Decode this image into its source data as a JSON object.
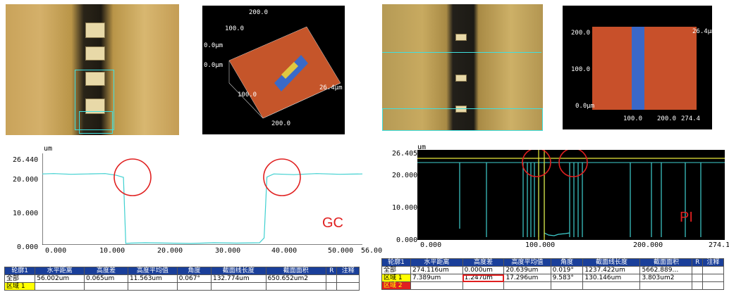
{
  "top": {
    "panel2": {
      "label_100_top": "100.0",
      "label_200_top": "200.0",
      "label_0_a": "0.0μm",
      "label_0_b": "0.0μm",
      "label_100_bottom": "100.0",
      "label_200_bottom": "200.0",
      "label_z": "26.4μm"
    },
    "panel4": {
      "y_200": "200.0",
      "y_100": "100.0",
      "x_0": "0.0μm",
      "x_100": "100.0",
      "x_200": "200.0",
      "x_end": "274.4",
      "z_label": "26.4μm"
    }
  },
  "gc_chart": {
    "unit": "um",
    "y_ticks": [
      "26.440",
      "20.000",
      "10.000",
      "0.000"
    ],
    "x_ticks": [
      "0.000",
      "10.000",
      "20.000",
      "30.000",
      "40.000",
      "50.000",
      "56.00"
    ],
    "label": "GC",
    "chart_data": {
      "type": "line",
      "x": [
        0,
        2,
        5,
        8,
        11,
        13,
        14.2,
        14.6,
        15.5,
        18,
        22,
        26,
        30,
        34,
        38,
        38.8,
        39.3,
        40.5,
        44,
        48,
        52,
        56
      ],
      "values": [
        20.5,
        20.6,
        20.4,
        20.5,
        20.6,
        20.1,
        19.5,
        0.4,
        0.5,
        0.6,
        0.5,
        0.4,
        0.6,
        0.5,
        0.6,
        2,
        19.6,
        20.5,
        20.3,
        20.6,
        20.4,
        20.5
      ],
      "ylim": [
        0,
        26.44
      ],
      "xlim": [
        0,
        56
      ]
    }
  },
  "pi_chart": {
    "unit": "um",
    "y_ticks": [
      "26.405",
      "20.000",
      "10.000",
      "0.000"
    ],
    "x_ticks": [
      "0.000",
      "100.000",
      "200.000",
      "274.1"
    ],
    "label": "PI",
    "ylim": [
      0,
      26.405
    ],
    "xlim": [
      0,
      274.116
    ]
  },
  "gc_table": {
    "headers": [
      "轮廓1",
      "水平距离",
      "高度差",
      "高度平均值",
      "角度",
      "截面线长度",
      "截面面积",
      "R",
      "注释"
    ],
    "rows": [
      [
        "全部",
        "56.002um",
        "0.065um",
        "11.563um",
        "0.067°",
        "132.774um",
        "650.652um2",
        "",
        ""
      ],
      [
        "区域 1",
        "",
        "",
        "",
        "",
        "",
        "",
        "",
        ""
      ]
    ]
  },
  "pi_table": {
    "headers": [
      "轮廓1",
      "水平距离",
      "高度差",
      "高度平均值",
      "角度",
      "截面线长度",
      "截面面积",
      "R",
      "注释"
    ],
    "rows": [
      [
        "全部",
        "274.116um",
        "0.000um",
        "20.639um",
        "0.019°",
        "1237.422um",
        "5662.889…",
        "",
        ""
      ],
      [
        "区域 1",
        "7.389um",
        "1.247um",
        "17.296um",
        "9.583°",
        "130.146um",
        "3.803um2",
        "",
        ""
      ],
      [
        "区域 2",
        "",
        "",
        "",
        "",
        "",
        "",
        "",
        ""
      ]
    ]
  },
  "colors": {
    "trace": "#3fd0d0",
    "highlight_circle": "#e02020",
    "table_header": "#1a3f9a",
    "yellow_row": "#ffff00"
  }
}
